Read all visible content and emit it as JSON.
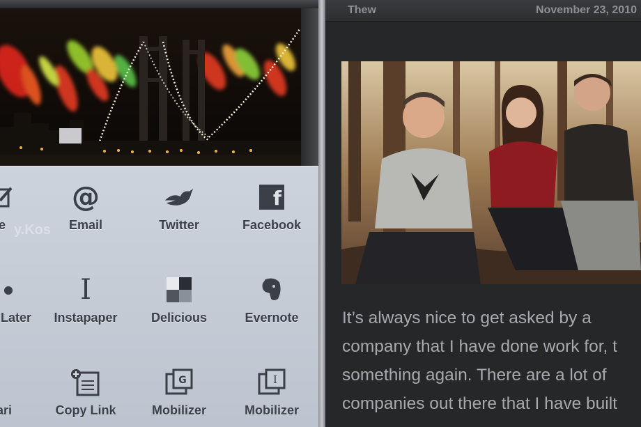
{
  "share_sheet": {
    "items": [
      {
        "label": "e",
        "icon": "edit-icon"
      },
      {
        "label": "Email",
        "icon": "at-icon"
      },
      {
        "label": "Twitter",
        "icon": "twitter-bird-icon"
      },
      {
        "label": "Facebook",
        "icon": "facebook-icon"
      },
      {
        "label": "Later",
        "icon": "read-later-icon"
      },
      {
        "label": "Instapaper",
        "icon": "instapaper-icon"
      },
      {
        "label": "Delicious",
        "icon": "delicious-icon"
      },
      {
        "label": "Evernote",
        "icon": "evernote-elephant-icon"
      },
      {
        "label": "ari",
        "icon": "safari-icon"
      },
      {
        "label": "Copy Link",
        "icon": "copy-link-icon"
      },
      {
        "label": "Mobilizer",
        "icon": "google-mobilizer-icon"
      },
      {
        "label": "Mobilizer",
        "icon": "instapaper-mobilizer-icon"
      }
    ]
  },
  "article": {
    "source": "Thew",
    "date": "November 23, 2010",
    "body_lines": [
      "It’s always nice to get asked by a",
      "company that I have done work for, t",
      "something again. There are a lot of",
      "companies out there that I have built"
    ]
  },
  "colors": {
    "share_sheet_bg": "#c5ccd6",
    "article_bg": "#262729",
    "article_text": "#a6a9ae",
    "header_text": "#8c8f95"
  }
}
